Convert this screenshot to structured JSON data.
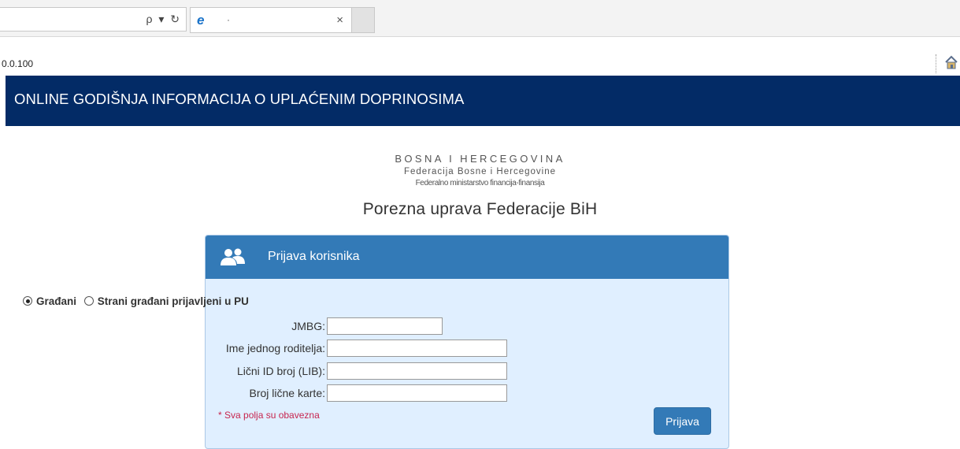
{
  "browser": {
    "address_tools": "ρ ▾ ↻",
    "tab_title": "·",
    "tab_close": "×",
    "url": "0.0.100"
  },
  "header": {
    "title": "ONLINE GODIŠNJA INFORMACIJA O UPLAĆENIM DOPRINOSIMA"
  },
  "logo": {
    "line1": "BOSNA I HERCEGOVINA",
    "line2": "Federacija Bosne i Hercegovine",
    "line3": "Federalno ministarstvo financija-finansija",
    "line4": "Porezna uprava Federacije BiH"
  },
  "login": {
    "title": "Prijava korisnika",
    "radio_citizens": "Građani",
    "radio_foreign": "Strani građani prijavljeni u PU",
    "jmbg_label": "JMBG:",
    "jmbg_value": "",
    "parent_label": "Ime jednog roditelja:",
    "parent_value": "",
    "lib_label": "Lični ID broj (LIB):",
    "lib_value": "",
    "idcard_label": "Broj lične karte:",
    "idcard_value": "",
    "required_note": "* Sva polja su obavezna",
    "submit_label": "Prijava"
  },
  "colors": {
    "header_bg": "#032b66",
    "panel_head": "#337ab7",
    "panel_body": "#e0efff",
    "required_text": "#c7254e"
  }
}
